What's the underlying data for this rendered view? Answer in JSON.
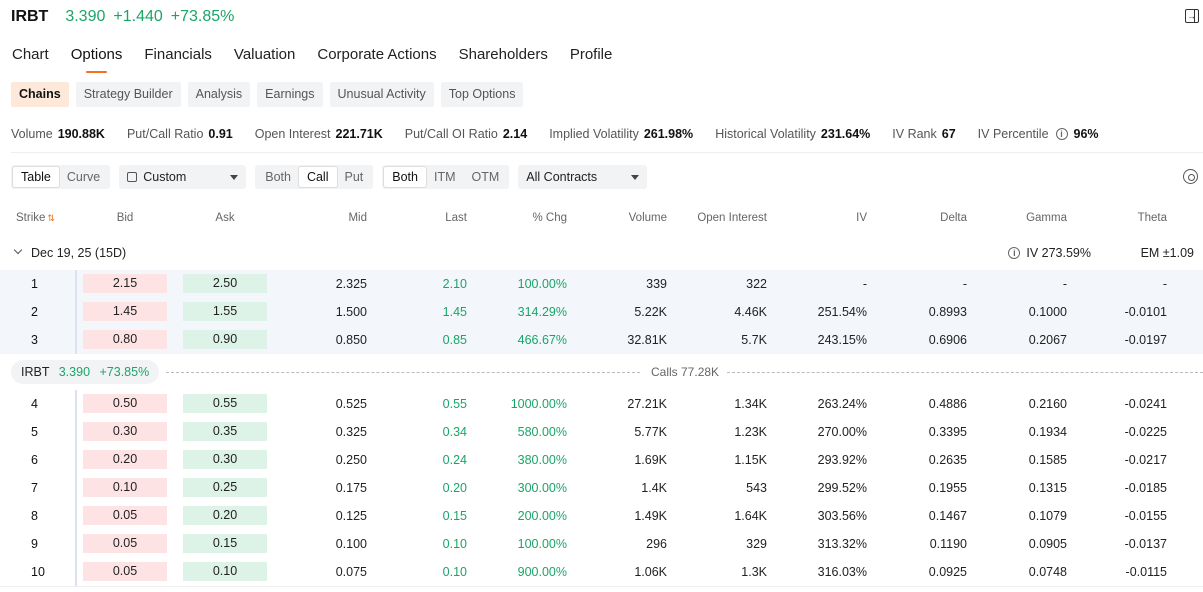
{
  "quote": {
    "symbol": "IRBT",
    "price": "3.390",
    "change": "+1.440",
    "change_pct": "+73.85%"
  },
  "nav_tabs": [
    "Chart",
    "Options",
    "Financials",
    "Valuation",
    "Corporate Actions",
    "Shareholders",
    "Profile"
  ],
  "sub_tabs": [
    "Chains",
    "Strategy Builder",
    "Analysis",
    "Earnings",
    "Unusual Activity",
    "Top Options"
  ],
  "stats": [
    {
      "label": "Volume",
      "value": "190.88K"
    },
    {
      "label": "Put/Call Ratio",
      "value": "0.91"
    },
    {
      "label": "Open Interest",
      "value": "221.71K"
    },
    {
      "label": "Put/Call OI Ratio",
      "value": "2.14"
    },
    {
      "label": "Implied Volatility",
      "value": "261.98%"
    },
    {
      "label": "Historical Volatility",
      "value": "231.64%"
    },
    {
      "label": "IV Rank",
      "value": "67"
    },
    {
      "label": "IV Percentile",
      "value": "96%"
    }
  ],
  "toolbar": {
    "view_options": [
      "Table",
      "Curve"
    ],
    "strategy": "Custom",
    "side_options": [
      "Both",
      "Call",
      "Put"
    ],
    "money_options": [
      "Both",
      "ITM",
      "OTM"
    ],
    "contracts": "All Contracts"
  },
  "columns": [
    "Strike",
    "Bid",
    "Ask",
    "Mid",
    "Last",
    "% Chg",
    "Volume",
    "Open Interest",
    "IV",
    "Delta",
    "Gamma",
    "Theta"
  ],
  "expiry": {
    "label": "Dec 19, 25 (15D)",
    "iv": "IV 273.59%",
    "em": "EM ±1.09"
  },
  "separator": {
    "symbol": "IRBT",
    "price": "3.390",
    "change_pct": "+73.85%",
    "calls_label": "Calls 77.28K"
  },
  "rows": [
    {
      "strike": "1",
      "bid": "2.15",
      "ask": "2.50",
      "mid": "2.325",
      "last": "2.10",
      "chg": "100.00%",
      "volume": "339",
      "oi": "322",
      "iv": "-",
      "delta": "-",
      "gamma": "-",
      "theta": "-"
    },
    {
      "strike": "2",
      "bid": "1.45",
      "ask": "1.55",
      "mid": "1.500",
      "last": "1.45",
      "chg": "314.29%",
      "volume": "5.22K",
      "oi": "4.46K",
      "iv": "251.54%",
      "delta": "0.8993",
      "gamma": "0.1000",
      "theta": "-0.0101"
    },
    {
      "strike": "3",
      "bid": "0.80",
      "ask": "0.90",
      "mid": "0.850",
      "last": "0.85",
      "chg": "466.67%",
      "volume": "32.81K",
      "oi": "5.7K",
      "iv": "243.15%",
      "delta": "0.6906",
      "gamma": "0.2067",
      "theta": "-0.0197"
    },
    {
      "strike": "4",
      "bid": "0.50",
      "ask": "0.55",
      "mid": "0.525",
      "last": "0.55",
      "chg": "1000.00%",
      "volume": "27.21K",
      "oi": "1.34K",
      "iv": "263.24%",
      "delta": "0.4886",
      "gamma": "0.2160",
      "theta": "-0.0241"
    },
    {
      "strike": "5",
      "bid": "0.30",
      "ask": "0.35",
      "mid": "0.325",
      "last": "0.34",
      "chg": "580.00%",
      "volume": "5.77K",
      "oi": "1.23K",
      "iv": "270.00%",
      "delta": "0.3395",
      "gamma": "0.1934",
      "theta": "-0.0225"
    },
    {
      "strike": "6",
      "bid": "0.20",
      "ask": "0.30",
      "mid": "0.250",
      "last": "0.24",
      "chg": "380.00%",
      "volume": "1.69K",
      "oi": "1.15K",
      "iv": "293.92%",
      "delta": "0.2635",
      "gamma": "0.1585",
      "theta": "-0.0217"
    },
    {
      "strike": "7",
      "bid": "0.10",
      "ask": "0.25",
      "mid": "0.175",
      "last": "0.20",
      "chg": "300.00%",
      "volume": "1.4K",
      "oi": "543",
      "iv": "299.52%",
      "delta": "0.1955",
      "gamma": "0.1315",
      "theta": "-0.0185"
    },
    {
      "strike": "8",
      "bid": "0.05",
      "ask": "0.20",
      "mid": "0.125",
      "last": "0.15",
      "chg": "200.00%",
      "volume": "1.49K",
      "oi": "1.64K",
      "iv": "303.56%",
      "delta": "0.1467",
      "gamma": "0.1079",
      "theta": "-0.0155"
    },
    {
      "strike": "9",
      "bid": "0.05",
      "ask": "0.15",
      "mid": "0.100",
      "last": "0.10",
      "chg": "100.00%",
      "volume": "296",
      "oi": "329",
      "iv": "313.32%",
      "delta": "0.1190",
      "gamma": "0.0905",
      "theta": "-0.0137"
    },
    {
      "strike": "10",
      "bid": "0.05",
      "ask": "0.10",
      "mid": "0.075",
      "last": "0.10",
      "chg": "900.00%",
      "volume": "1.06K",
      "oi": "1.3K",
      "iv": "316.03%",
      "delta": "0.0925",
      "gamma": "0.0748",
      "theta": "-0.0115"
    }
  ],
  "colors": {
    "up": "#1aa567",
    "accent": "#f37021",
    "bid_bg": "#fde3e4",
    "ask_bg": "#ddf3e7"
  }
}
